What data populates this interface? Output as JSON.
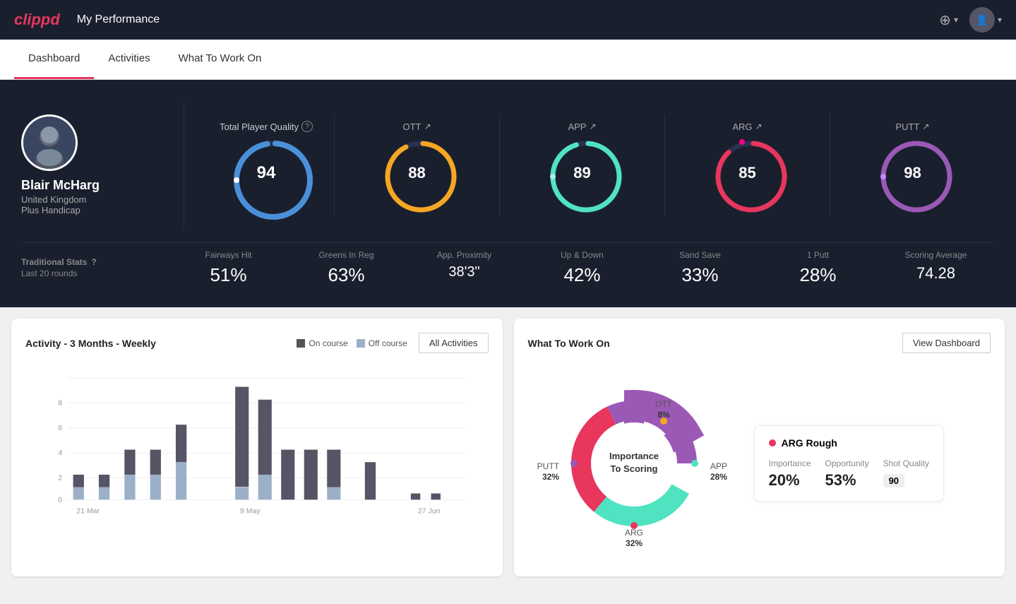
{
  "header": {
    "logo": "clippd",
    "title": "My Performance",
    "add_icon": "⊕",
    "avatar_icon": "👤"
  },
  "nav": {
    "tabs": [
      {
        "id": "dashboard",
        "label": "Dashboard",
        "active": true
      },
      {
        "id": "activities",
        "label": "Activities",
        "active": false
      },
      {
        "id": "what-to-work-on",
        "label": "What To Work On",
        "active": false
      }
    ]
  },
  "player": {
    "name": "Blair McHarg",
    "country": "United Kingdom",
    "handicap": "Plus Handicap"
  },
  "total_quality": {
    "label": "Total Player Quality",
    "value": 94,
    "color": "#4a90d9"
  },
  "score_cards": [
    {
      "id": "ott",
      "label": "OTT",
      "value": 88,
      "color": "#f5a623",
      "trend": "↗"
    },
    {
      "id": "app",
      "label": "APP",
      "value": 89,
      "color": "#50e3c2",
      "trend": "↗"
    },
    {
      "id": "arg",
      "label": "ARG",
      "value": 85,
      "color": "#e8365d",
      "trend": "↗"
    },
    {
      "id": "putt",
      "label": "PUTT",
      "value": 98,
      "color": "#9b59b6",
      "trend": "↗"
    }
  ],
  "traditional_stats": {
    "title": "Traditional Stats",
    "period": "Last 20 rounds",
    "stats": [
      {
        "label": "Fairways Hit",
        "value": "51%"
      },
      {
        "label": "Greens In Reg",
        "value": "63%"
      },
      {
        "label": "App. Proximity",
        "value": "38'3\""
      },
      {
        "label": "Up & Down",
        "value": "42%"
      },
      {
        "label": "Sand Save",
        "value": "33%"
      },
      {
        "label": "1 Putt",
        "value": "28%"
      },
      {
        "label": "Scoring Average",
        "value": "74.28"
      }
    ]
  },
  "activity_chart": {
    "title": "Activity - 3 Months - Weekly",
    "legend": [
      {
        "label": "On course",
        "color": "#555"
      },
      {
        "label": "Off course",
        "color": "#9bb0c8"
      }
    ],
    "all_activities_btn": "All Activities",
    "x_labels": [
      "21 Mar",
      "9 May",
      "27 Jun"
    ],
    "y_labels": [
      "0",
      "2",
      "4",
      "6",
      "8"
    ],
    "bars": [
      {
        "on": 1,
        "off": 1
      },
      {
        "on": 1,
        "off": 1
      },
      {
        "on": 2,
        "off": 2
      },
      {
        "on": 2,
        "off": 2
      },
      {
        "on": 3,
        "off": 3
      },
      {
        "on": 8,
        "off": 1
      },
      {
        "on": 6,
        "off": 2
      },
      {
        "on": 4,
        "off": 0
      },
      {
        "on": 4,
        "off": 0
      },
      {
        "on": 3,
        "off": 1
      },
      {
        "on": 3,
        "off": 0
      },
      {
        "on": 0.5,
        "off": 0
      },
      {
        "on": 0.5,
        "off": 0
      }
    ]
  },
  "what_to_work_on": {
    "title": "What To Work On",
    "view_dashboard_btn": "View Dashboard",
    "donut_center": "Importance\nTo Scoring",
    "segments": [
      {
        "label": "OTT",
        "pct": "8%",
        "color": "#f5a623",
        "angle_start": 0,
        "angle_end": 29
      },
      {
        "label": "APP",
        "pct": "28%",
        "color": "#50e3c2",
        "angle_start": 29,
        "angle_end": 130
      },
      {
        "label": "ARG",
        "pct": "32%",
        "color": "#e8365d",
        "angle_start": 130,
        "angle_end": 245
      },
      {
        "label": "PUTT",
        "pct": "32%",
        "color": "#9b59b6",
        "angle_start": 245,
        "angle_end": 360
      }
    ],
    "info_card": {
      "title": "ARG Rough",
      "dot_color": "#e8365d",
      "metrics": [
        {
          "label": "Importance",
          "value": "20%"
        },
        {
          "label": "Opportunity",
          "value": "53%"
        },
        {
          "label": "Shot Quality",
          "value": "90"
        }
      ]
    }
  }
}
